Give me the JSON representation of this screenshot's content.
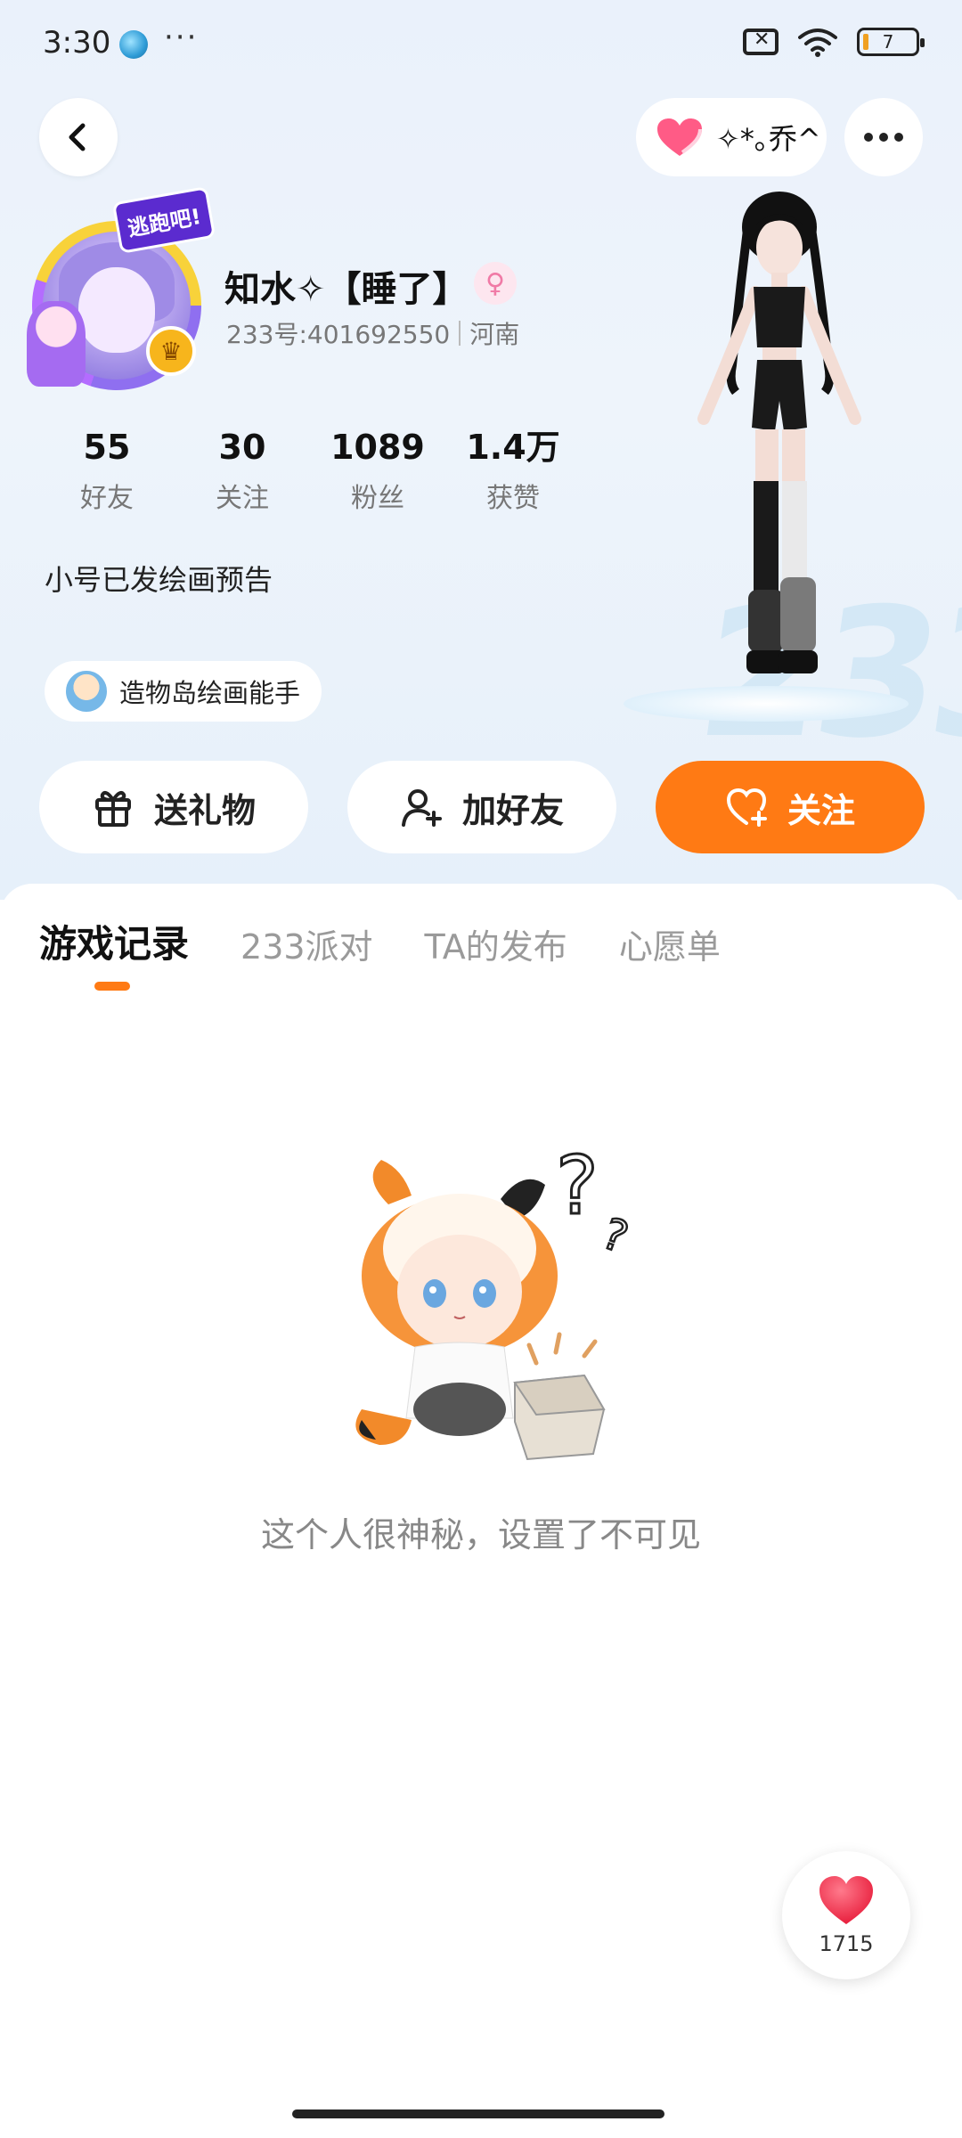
{
  "status_bar": {
    "time": "3:30",
    "more": "···",
    "battery_level": "7"
  },
  "header": {
    "visitor_name": "✧*｡乔^"
  },
  "profile": {
    "avatar_badge": "逃跑吧!",
    "name": "知水✧【睡了】",
    "user_id": "233号:401692550",
    "location": "河南",
    "stats": [
      {
        "value": "55",
        "label": "好友"
      },
      {
        "value": "30",
        "label": "关注"
      },
      {
        "value": "1089",
        "label": "粉丝"
      },
      {
        "value": "1.4万",
        "label": "获赞"
      }
    ],
    "bio": "小号已发绘画预告",
    "tag": "造物岛绘画能手"
  },
  "actions": {
    "gift": "送礼物",
    "add_friend": "加好友",
    "follow": "关注"
  },
  "tabs": [
    {
      "label": "游戏记录",
      "active": true
    },
    {
      "label": "233派对",
      "active": false
    },
    {
      "label": "TA的发布",
      "active": false
    },
    {
      "label": "心愿单",
      "active": false
    }
  ],
  "empty_state": {
    "message": "这个人很神秘，设置了不可见"
  },
  "like": {
    "count": "1715"
  },
  "colors": {
    "accent": "#ff7a14",
    "heart": "#f0365a",
    "hero_bg": "#eaf1fb"
  },
  "icons": [
    "back-icon",
    "heart-icon",
    "more-icon",
    "gift-icon",
    "add-friend-icon",
    "follow-heart-icon",
    "female-icon",
    "crown-icon"
  ]
}
